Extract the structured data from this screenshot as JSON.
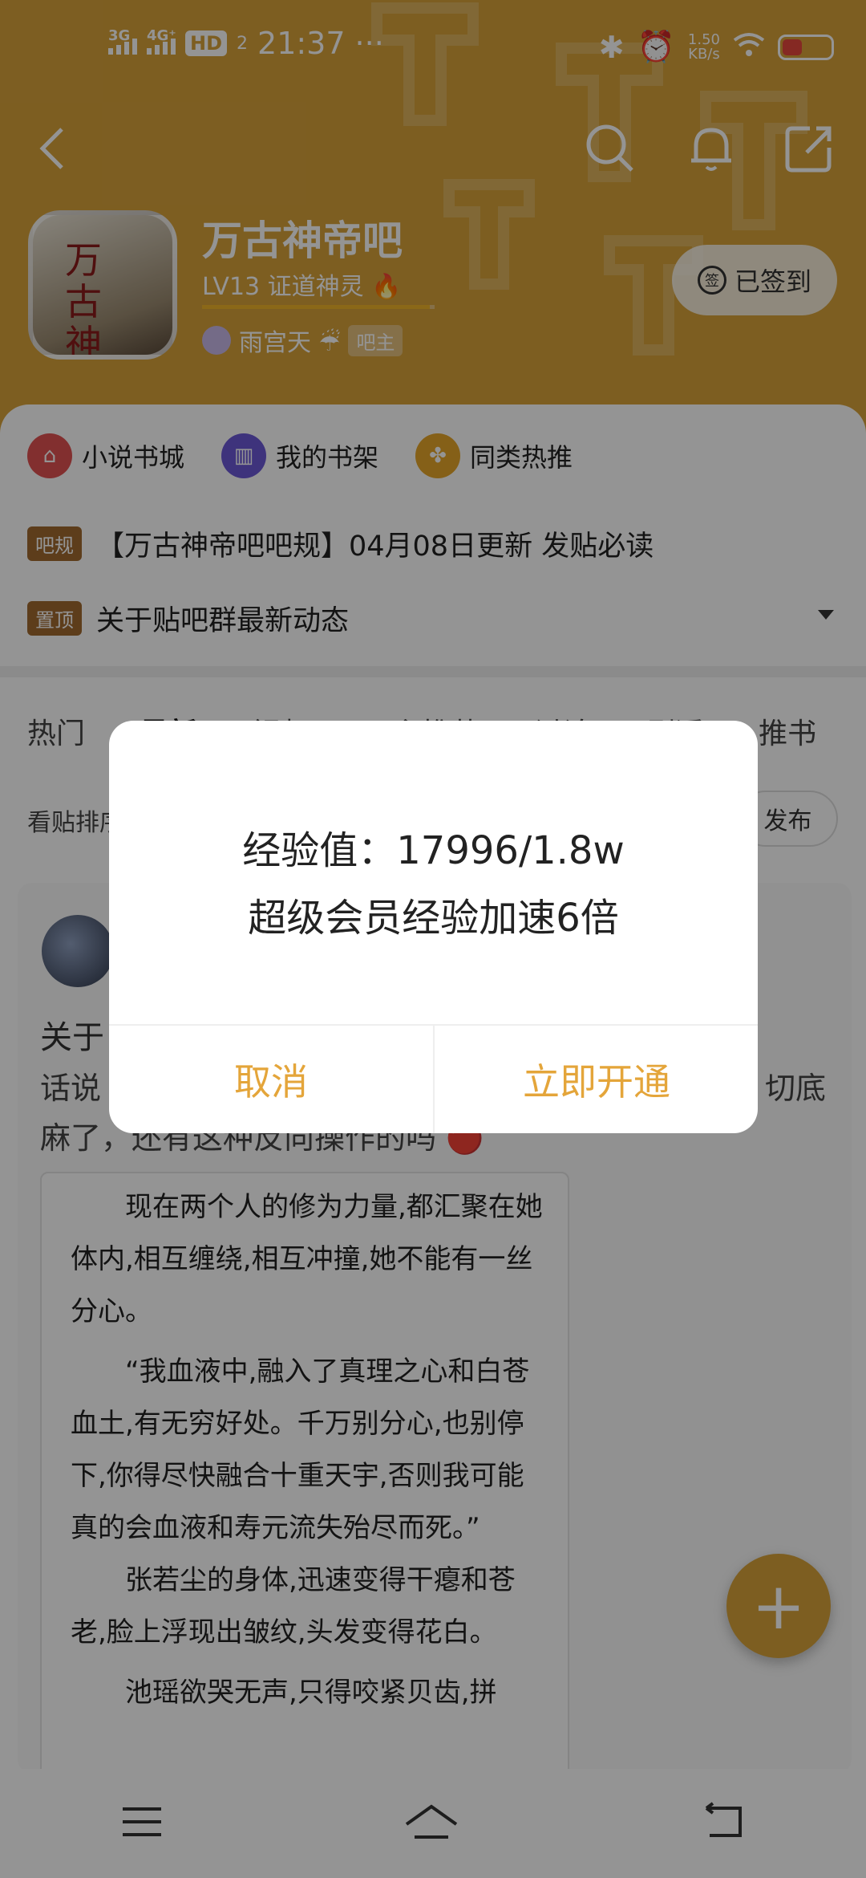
{
  "status_bar": {
    "signal1": "3G",
    "signal2": "4G⁺",
    "hd": "HD",
    "hd_sub": "2",
    "time": "21:37",
    "more": "···",
    "net_speed_value": "1.50",
    "net_speed_unit": "KB/s",
    "battery_level": "41",
    "battery_fraction": 0.41
  },
  "forum": {
    "cover_text": "万古神帝",
    "title": "万古神帝吧",
    "level": "LV13 证道神灵 🔥",
    "level_progress": 0.98,
    "owner_name": "雨宫天 ☔",
    "owner_tag": "吧主",
    "signin_seal": "签",
    "signin_label": "已签到"
  },
  "quick_links": [
    {
      "label": "小说书城",
      "color": "#e15151"
    },
    {
      "label": "我的书架",
      "color": "#6c59d6"
    },
    {
      "label": "同类热推",
      "color": "#e5a62a"
    }
  ],
  "notices": [
    {
      "badge": "吧规",
      "text": "【万古神帝吧吧规】04月08日更新 发贴必读"
    },
    {
      "badge": "置顶",
      "text": "关于贴吧群最新动态"
    }
  ],
  "tabs": [
    "热门",
    "最新",
    "视频",
    "吧主推荐",
    "讨论",
    "剧透",
    "推书"
  ],
  "sort_label": "看贴排序",
  "publish_label": "发布",
  "post": {
    "title": "关于",
    "body_line1": "话说",
    "body_tail": "切底",
    "body_line2": "麻了，还有这种反向操作的吗 🔴",
    "quote_paragraphs": [
      "现在两个人的修为力量,都汇聚在她体内,相互缠绕,相互冲撞,她不能有一丝分心。",
      "“我血液中,融入了真理之心和白苍血土,有无穷好处。千万别分心,也别停下,你得尽快融合十重天宇,否则我可能真的会血液和寿元流失殆尽而死。”",
      "张若尘的身体,迅速变得干瘪和苍老,脸上浮现出皱纹,头发变得花白。",
      "池瑶欲哭无声,只得咬紧贝齿,拼"
    ]
  },
  "fab_label": "+",
  "dialog": {
    "line1": "经验值：17996/1.8w",
    "line2": "超级会员经验加速6倍",
    "cancel": "取消",
    "confirm": "立即开通"
  },
  "colors": {
    "header": "#d7a23a",
    "accent": "#e4a53a"
  }
}
